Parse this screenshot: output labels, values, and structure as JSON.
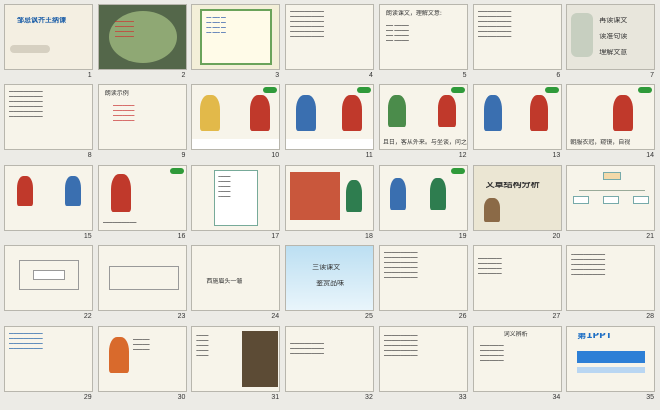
{
  "slides": [
    {
      "n": "1",
      "title": "邹忌讽齐王纳谏"
    },
    {
      "n": "2",
      "title": ""
    },
    {
      "n": "3",
      "title": ""
    },
    {
      "n": "4",
      "title": ""
    },
    {
      "n": "5",
      "title": "朗读课文，理解文意:"
    },
    {
      "n": "6",
      "title": ""
    },
    {
      "n": "7",
      "lines": [
        "再读课文",
        "读准句读",
        "理解文意"
      ]
    },
    {
      "n": "8",
      "title": ""
    },
    {
      "n": "9",
      "title": "朗读示例"
    },
    {
      "n": "10",
      "title": ""
    },
    {
      "n": "11",
      "title": ""
    },
    {
      "n": "12",
      "title": "且日，客从外来。与坐谈，问之"
    },
    {
      "n": "13",
      "title": ""
    },
    {
      "n": "14",
      "title": "朝服衣冠，窥镜，自视"
    },
    {
      "n": "15",
      "title": ""
    },
    {
      "n": "16",
      "title": ""
    },
    {
      "n": "17",
      "title": ""
    },
    {
      "n": "18",
      "title": ""
    },
    {
      "n": "19",
      "title": ""
    },
    {
      "n": "20",
      "title": "文章结构分析"
    },
    {
      "n": "21",
      "title": ""
    },
    {
      "n": "22",
      "title": ""
    },
    {
      "n": "23",
      "title": ""
    },
    {
      "n": "24",
      "title": "西施眉头一皱"
    },
    {
      "n": "25",
      "lines": [
        "三读课文",
        "鉴赏品味"
      ]
    },
    {
      "n": "26",
      "title": ""
    },
    {
      "n": "27",
      "title": ""
    },
    {
      "n": "28",
      "title": ""
    },
    {
      "n": "29",
      "title": ""
    },
    {
      "n": "30",
      "title": ""
    },
    {
      "n": "31",
      "title": ""
    },
    {
      "n": "32",
      "title": ""
    },
    {
      "n": "33",
      "title": ""
    },
    {
      "n": "34",
      "title": "词义辨析"
    },
    {
      "n": "35",
      "title": "第1PPT"
    }
  ],
  "colors": {
    "slide_bg": "#f7f4ea",
    "border": "#b8b6ad",
    "accent_green": "#2f9a3a",
    "dark": "#1d2a25"
  }
}
